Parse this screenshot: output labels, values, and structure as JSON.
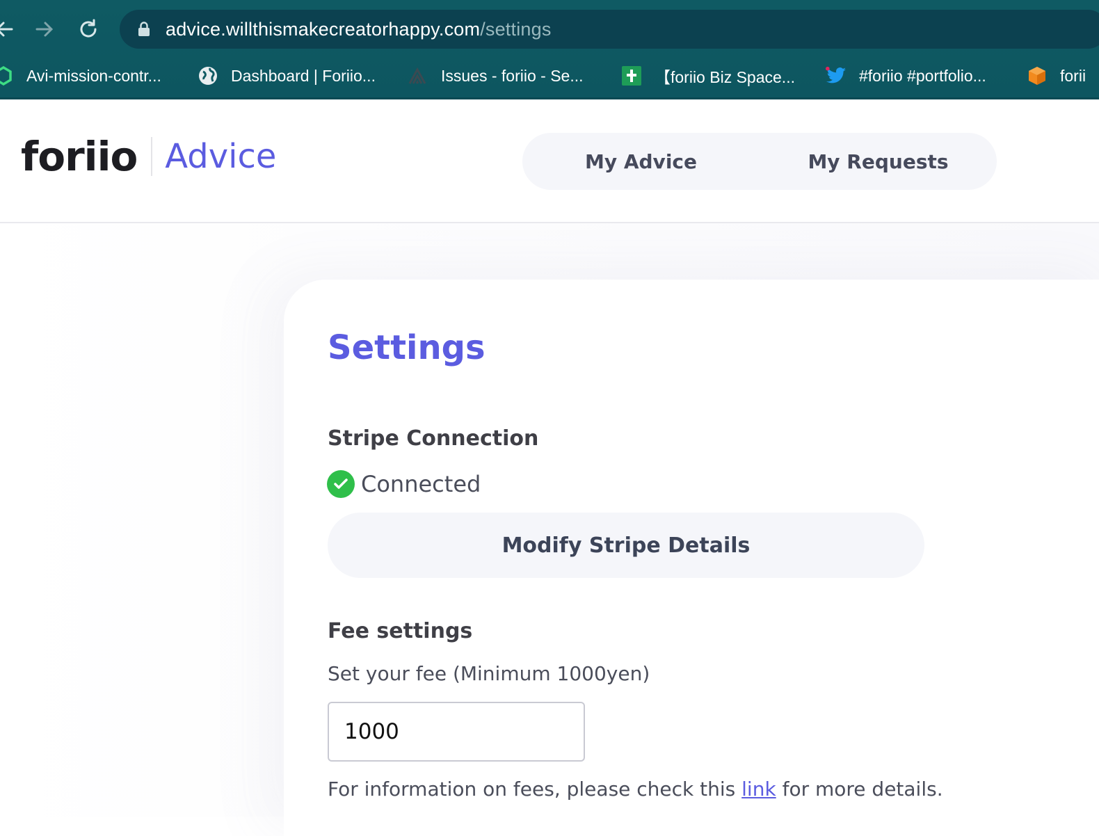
{
  "browser": {
    "url_host": "advice.willthismakecreatorhappy.com",
    "url_path": "/settings",
    "bookmarks": [
      {
        "label": "Avi-mission-contr...",
        "icon": "hexagon-icon"
      },
      {
        "label": "Dashboard | Foriio...",
        "icon": "globe-icon"
      },
      {
        "label": "Issues - foriio - Se...",
        "icon": "sentry-icon"
      },
      {
        "label": "【foriio Biz Space...",
        "icon": "sheets-icon"
      },
      {
        "label": "#foriio #portfolio...",
        "icon": "twitter-icon"
      },
      {
        "label": "forii",
        "icon": "cube-icon"
      }
    ]
  },
  "header": {
    "logo_word": "foriio",
    "logo_product": "Advice",
    "nav": [
      {
        "label": "My Advice"
      },
      {
        "label": "My Requests"
      }
    ]
  },
  "settings": {
    "title": "Settings",
    "stripe": {
      "heading": "Stripe Connection",
      "status": "Connected",
      "status_color": "#2fbf4a",
      "button_label": "Modify Stripe Details"
    },
    "fee": {
      "heading": "Fee settings",
      "label": "Set your fee (Minimum 1000yen)",
      "value": "1000",
      "info_before": "For information on fees, please check this ",
      "info_link": "link",
      "info_after": " for more details."
    }
  },
  "colors": {
    "accent": "#5b5ce0",
    "chrome": "#0f5a63"
  }
}
